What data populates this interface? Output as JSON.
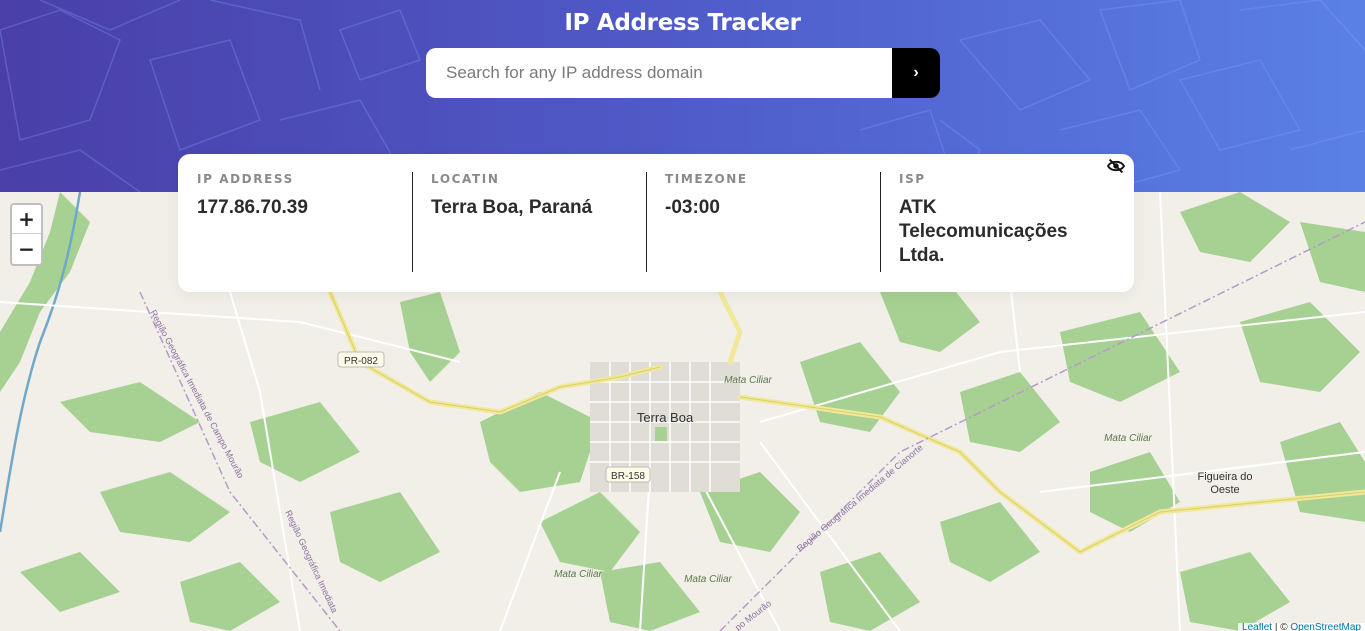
{
  "header": {
    "title": "IP Address Tracker",
    "search_placeholder": "Search for any IP address domain",
    "submit_glyph": "›"
  },
  "info": {
    "ip_label": "IP ADDRESS",
    "ip_value": "177.86.70.39",
    "location_label": "LOCATIN",
    "location_value": "Terra Boa, Paraná",
    "timezone_label": "TIMEZONE",
    "timezone_value": "-03:00",
    "isp_label": "ISP",
    "isp_value_line1": "ATK",
    "isp_value_line2": "Telecomunicações",
    "isp_value_line3": "Ltda.",
    "hide_icon": "eye-slash-icon"
  },
  "map": {
    "zoom_in": "+",
    "zoom_out": "−",
    "labels": {
      "city": "Terra Boa",
      "road1": "PR-082",
      "road2": "BR-158",
      "forest1": "Mata Ciliar",
      "forest2": "Mata Ciliar",
      "forest3": "Mata Ciliar",
      "forest4": "Mata Ciliar",
      "town_line1": "Figueira do",
      "town_line2": "Oeste",
      "region1": "Região Geográfica Imediata de Campo Mourão",
      "region2": "Região Geográfica Imediata de Cianorte",
      "region3": "Região Geográfica Imediata",
      "region4": "po Mourão"
    },
    "attribution_leaflet": "Leaflet",
    "attribution_sep": " | © ",
    "attribution_osm": "OpenStreetMap"
  },
  "colors": {
    "header_start": "#4a3fa8",
    "header_end": "#5a80e6",
    "map_bg": "#f2efe9",
    "forest": "#a6d193",
    "road_major": "#f7f4a8",
    "road_minor": "#ffffff"
  }
}
